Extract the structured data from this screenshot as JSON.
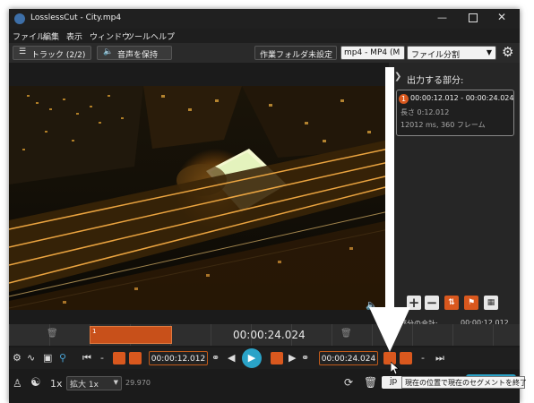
{
  "window": {
    "title": "LosslessCut - City.mp4"
  },
  "menu": [
    "ファイル",
    "編集",
    "表示",
    "ウィンドウ",
    "ツール",
    "ヘルプ"
  ],
  "toolbar": {
    "tracks_label": "トラック (2/2)",
    "audio_label": "音声を保持",
    "workdir_label": "作業フォルダ未設定",
    "format_value": "mp4 - MP4 (M",
    "mode_value": "ファイル分割"
  },
  "side_panel": {
    "header": "出力する部分:",
    "segment": {
      "index": "1",
      "range": "00:00:12.012 - 00:00:24.024",
      "duration": "長さ 0:12.012",
      "info": "12012 ms, 360 フレーム"
    },
    "total_label": "力部分の合計:",
    "total_value": "00:00:12.012"
  },
  "timeline": {
    "current_time": "00:00:24.024",
    "segment_label": "1"
  },
  "controls": {
    "start_time": "00:00:12.012",
    "end_time": "00:00:24.024"
  },
  "bottom": {
    "speed": "1x",
    "zoom_value": "拡大 1x",
    "fps": "29.970",
    "format_short": "jp"
  },
  "tooltip": {
    "text": "現在の位置で現在のセグメントを終了"
  },
  "colors": {
    "accent": "#d9581e",
    "play": "#2aa3c8",
    "background": "#1b1b1b"
  }
}
